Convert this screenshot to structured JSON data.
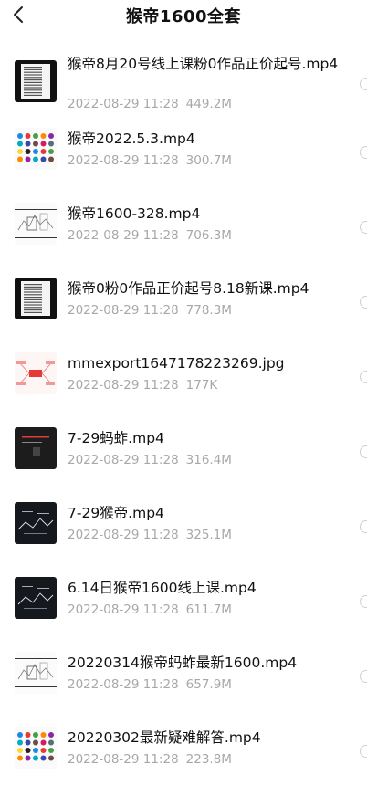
{
  "header": {
    "title": "猴帝1600全套",
    "back_icon": "chevron-left-icon"
  },
  "colors": {
    "text": "#111111",
    "meta": "#a8a8a8",
    "circle_border": "#cfcfcf",
    "background": "#ffffff"
  },
  "files": [
    {
      "name": "猴帝8月20号线上课粉0作品正价起号.mp4",
      "date": "2022-08-29 11:28",
      "size": "449.2M",
      "thumb": "document-video-thumbnail"
    },
    {
      "name": "猴帝2022.5.3.mp4",
      "date": "2022-08-29 11:28",
      "size": "300.7M",
      "thumb": "icon-grid-thumbnail"
    },
    {
      "name": "猴帝1600-328.mp4",
      "date": "2022-08-29 11:28",
      "size": "706.3M",
      "thumb": "sketch-thumbnail"
    },
    {
      "name": "猴帝0粉0作品正价起号8.18新课.mp4",
      "date": "2022-08-29 11:28",
      "size": "778.3M",
      "thumb": "document-video-thumbnail"
    },
    {
      "name": "mmexport1647178223269.jpg",
      "date": "2022-08-29 11:28",
      "size": "177K",
      "thumb": "mindmap-thumbnail"
    },
    {
      "name": "7-29蚂蚱.mp4",
      "date": "2022-08-29 11:28",
      "size": "316.4M",
      "thumb": "dark-slide-thumbnail"
    },
    {
      "name": "7-29猴帝.mp4",
      "date": "2022-08-29 11:28",
      "size": "325.1M",
      "thumb": "blackboard-thumbnail"
    },
    {
      "name": "6.14日猴帝1600线上课.mp4",
      "date": "2022-08-29 11:28",
      "size": "611.7M",
      "thumb": "blackboard-thumbnail"
    },
    {
      "name": "20220314猴帝蚂蚱最新1600.mp4",
      "date": "2022-08-29 11:28",
      "size": "657.9M",
      "thumb": "sketch-thumbnail"
    },
    {
      "name": "20220302最新疑难解答.mp4",
      "date": "2022-08-29 11:28",
      "size": "223.8M",
      "thumb": "icon-grid-thumbnail"
    }
  ]
}
